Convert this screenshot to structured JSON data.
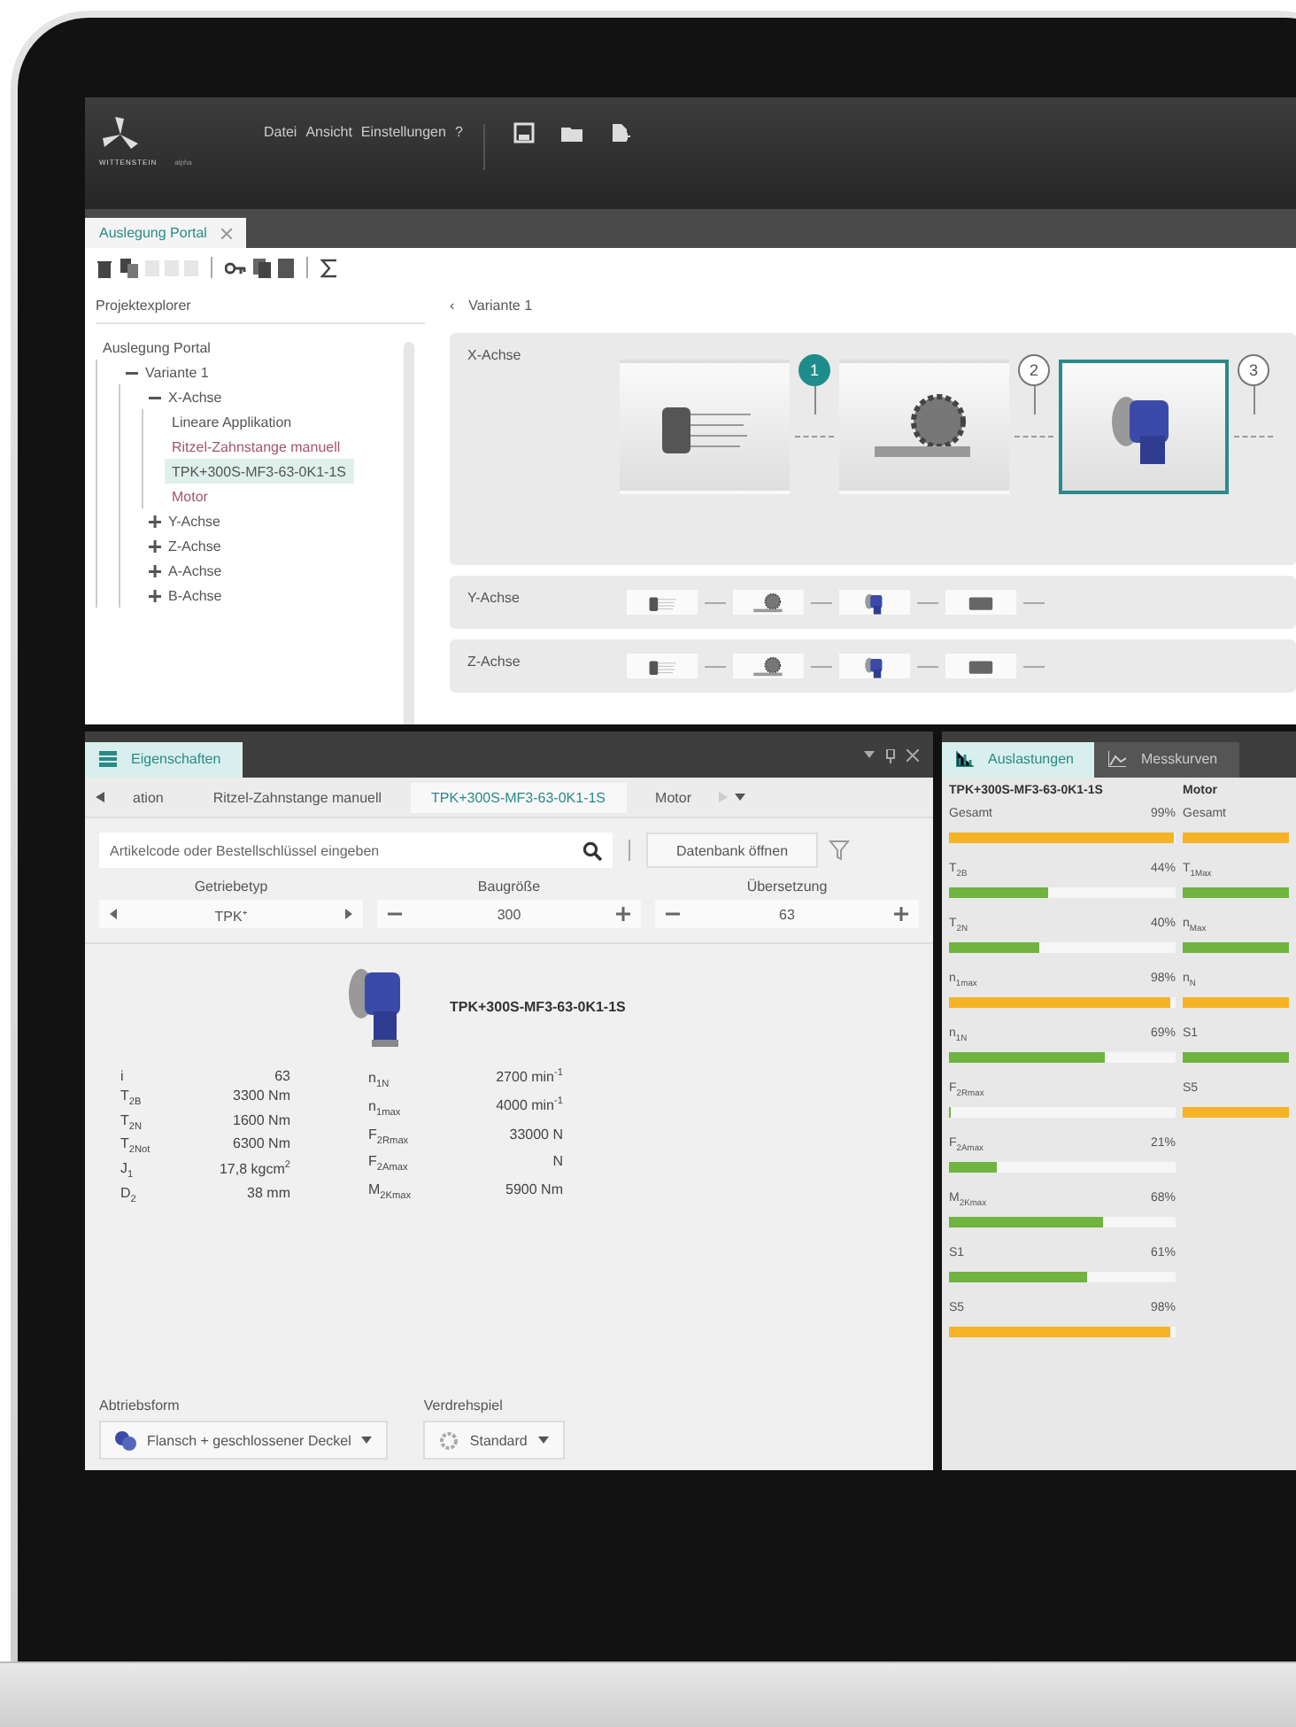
{
  "app": {
    "logo_text": "WITTENSTEIN",
    "logo_sub": "alpha",
    "menu": [
      "Datei",
      "Ansicht",
      "Einstellungen",
      "?"
    ]
  },
  "doc_tabs": [
    {
      "label": "Auslegung Portal",
      "selected": true
    }
  ],
  "explorer": {
    "title": "Projektexplorer",
    "tree": [
      {
        "label": "Auslegung Portal",
        "selected": false,
        "children": [
          {
            "label": "Variante 1",
            "expanded": true,
            "selected": false,
            "children": [
              {
                "label": "X-Achse",
                "expanded": true,
                "selected": false,
                "children": [
                  {
                    "label": "Lineare Applikation",
                    "selected": false,
                    "color": "#555555"
                  },
                  {
                    "label": "Ritzel-Zahnstange manuell",
                    "selected": false,
                    "color": "#a4566a"
                  },
                  {
                    "label": "TPK+300S-MF3-63-0K1-1S",
                    "selected": true,
                    "color": "#555555"
                  },
                  {
                    "label": "Motor",
                    "selected": false,
                    "color": "#a4566a"
                  }
                ]
              },
              {
                "label": "Y-Achse",
                "expanded": false,
                "selected": false
              },
              {
                "label": "Z-Achse",
                "expanded": false,
                "selected": false
              },
              {
                "label": "A-Achse",
                "expanded": false,
                "selected": false
              },
              {
                "label": "B-Achse",
                "expanded": false,
                "selected": false
              }
            ]
          }
        ]
      }
    ]
  },
  "variant": {
    "collapse": "‹",
    "title": "Variante 1",
    "axes": [
      {
        "label": "X-Achse",
        "kind": "expanded",
        "components": [
          {
            "kind": "linear",
            "selected": false,
            "pin": "1",
            "pin_selected": true
          },
          {
            "kind": "rack",
            "selected": false,
            "pin": "2",
            "pin_selected": false
          },
          {
            "kind": "gearbox",
            "selected": true,
            "pin": "3",
            "pin_selected": false
          }
        ]
      },
      {
        "label": "Y-Achse",
        "kind": "compact",
        "components": [
          {
            "kind": "linear"
          },
          {
            "kind": "rack"
          },
          {
            "kind": "gearbox"
          },
          {
            "kind": "motor"
          }
        ]
      },
      {
        "label": "Z-Achse",
        "kind": "compact",
        "components": [
          {
            "kind": "linear"
          },
          {
            "kind": "rack"
          },
          {
            "kind": "gearbox"
          },
          {
            "kind": "motor"
          }
        ]
      }
    ]
  },
  "properties": {
    "title": "Eigenschaften",
    "selected": true,
    "tabs": [
      {
        "label": "ation",
        "selected": false
      },
      {
        "label": "Ritzel-Zahnstange manuell",
        "selected": false
      },
      {
        "label": "TPK+300S-MF3-63-0K1-1S",
        "selected": true
      },
      {
        "label": "Motor",
        "selected": false
      }
    ],
    "search": {
      "placeholder": "Artikelcode oder Bestellschlüssel eingeben"
    },
    "db_button": "Datenbank öffnen",
    "steppers": [
      {
        "label": "Getriebetyp",
        "value": "TPK⁺",
        "kind": "select"
      },
      {
        "label": "Baugröße",
        "value": "300",
        "kind": "number"
      },
      {
        "label": "Übersetzung",
        "value": "63",
        "kind": "number"
      }
    ],
    "product": {
      "name": "TPK+300S-MF3-63-0K1-1S",
      "specs_left": [
        {
          "label": "i",
          "value": "63"
        },
        {
          "label": "T$_{2B}$",
          "value": "3300 Nm"
        },
        {
          "label": "T$_{2N}$",
          "value": "1600 Nm"
        },
        {
          "label": "T$_{2Not}$",
          "value": "6300 Nm"
        },
        {
          "label": "J$_{1}$",
          "value": "17,8 kgcm$^{2}$"
        },
        {
          "label": "D$_{2}$",
          "value": "38 mm"
        }
      ],
      "specs_right": [
        {
          "label": "n$_{1N}$",
          "value": "2700 min$^{-1}$"
        },
        {
          "label": "n$_{1max}$",
          "value": "4000 min$^{-1}$"
        },
        {
          "label": "F$_{2Rmax}$",
          "value": "33000 N"
        },
        {
          "label": "F$_{2Amax}$",
          "value": "N"
        },
        {
          "label": "M$_{2Kmax}$",
          "value": "5900 Nm"
        }
      ]
    },
    "dropdowns": [
      {
        "label": "Abtriebsform",
        "value": "Flansch + geschlossener Deckel",
        "kind": "flange"
      },
      {
        "label": "Verdrehspiel",
        "value": "Standard",
        "kind": "backlash"
      }
    ]
  },
  "loads": {
    "tabs": [
      {
        "label": "Auslastungen",
        "selected": true
      },
      {
        "label": "Messkurven",
        "selected": false
      }
    ],
    "columns": [
      {
        "title": "TPK+300S-MF3-63-0K1-1S",
        "rows": [
          {
            "label": "Gesamt",
            "reading": "99%",
            "level": 0.99,
            "color": "#f5b325"
          },
          {
            "label": "T$_{2B}$",
            "reading": "44%",
            "level": 0.44,
            "color": "#6fb43f"
          },
          {
            "label": "T$_{2N}$",
            "reading": "40%",
            "level": 0.4,
            "color": "#6fb43f"
          },
          {
            "label": "n$_{1max}$",
            "reading": "98%",
            "level": 0.98,
            "color": "#f5b325"
          },
          {
            "label": "n$_{1N}$",
            "reading": "69%",
            "level": 0.69,
            "color": "#6fb43f"
          },
          {
            "label": "F$_{2Rmax}$",
            "level": 0,
            "color": "#6fb43f"
          },
          {
            "label": "F$_{2Amax}$",
            "reading": "21%",
            "level": 0.21,
            "color": "#6fb43f"
          },
          {
            "label": "M$_{2Kmax}$",
            "reading": "68%",
            "level": 0.68,
            "color": "#6fb43f"
          },
          {
            "label": "S1",
            "reading": "61%",
            "level": 0.61,
            "color": "#6fb43f"
          },
          {
            "label": "S5",
            "reading": "98%",
            "level": 0.98,
            "color": "#f5b325"
          }
        ]
      },
      {
        "title": "Motor",
        "rows": [
          {
            "label": "Gesamt",
            "level": 1,
            "color": "#f5b325"
          },
          {
            "label": "T$_{1Max}$",
            "level": 1,
            "color": "#6fb43f"
          },
          {
            "label": "n$_{Max}$",
            "level": 1,
            "color": "#6fb43f"
          },
          {
            "label": "n$_{N}$",
            "level": 1,
            "color": "#f5b325"
          },
          {
            "label": "S1",
            "level": 1,
            "color": "#6fb43f"
          },
          {
            "label": "S5",
            "level": 1,
            "color": "#f5b325"
          }
        ]
      }
    ]
  }
}
